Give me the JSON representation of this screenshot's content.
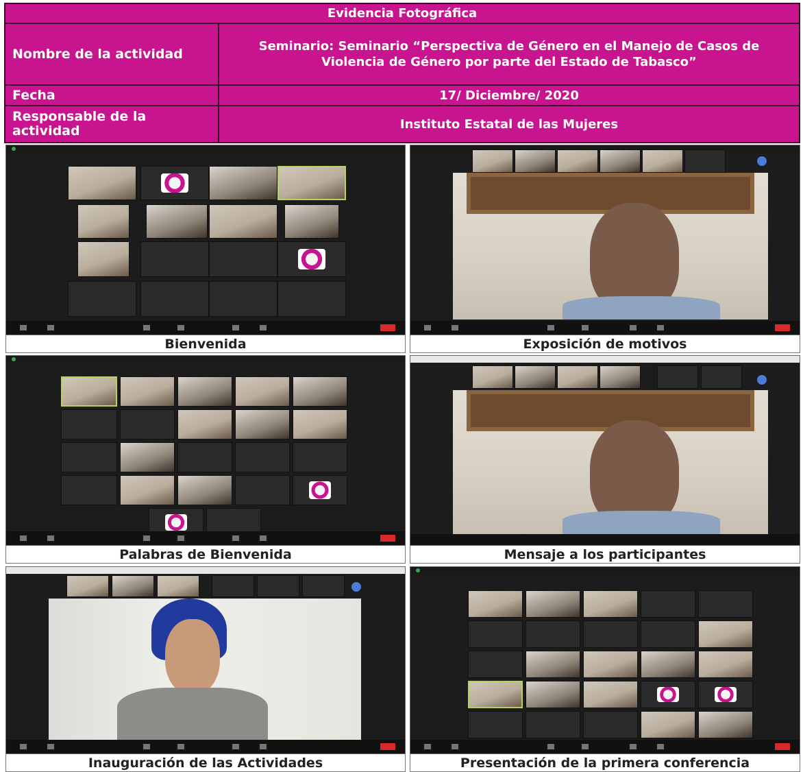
{
  "header": {
    "title": "Evidencia Fotográfica",
    "activity_label": "Nombre de la actividad",
    "activity_value": "Seminario: Seminario “Perspectiva de Género en el Manejo de Casos de Violencia de Género por parte del Estado de Tabasco”",
    "date_label": "Fecha",
    "date_value": "17/ Diciembre/ 2020",
    "responsible_label": "Responsable de la actividad",
    "responsible_value": "Instituto Estatal de las Mujeres"
  },
  "photos": [
    {
      "caption": "Bienvenida"
    },
    {
      "caption": "Exposición de motivos"
    },
    {
      "caption": "Palabras de Bienvenida"
    },
    {
      "caption": "Mensaje a los participantes"
    },
    {
      "caption": "Inauguración de las Actividades"
    },
    {
      "caption": "Presentación de la primera conferencia"
    }
  ],
  "colors": {
    "header_bg": "#c8158f",
    "header_text": "#ffffff",
    "meeting_bg": "#1c1c1c"
  }
}
